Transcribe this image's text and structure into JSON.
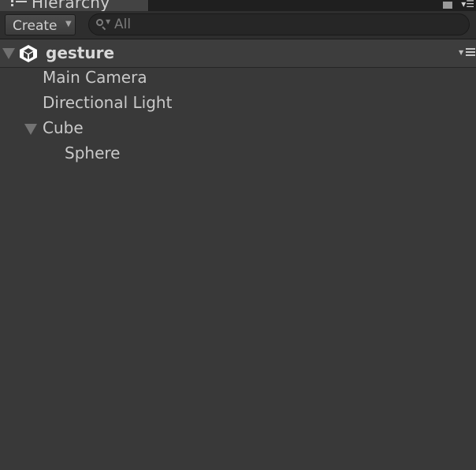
{
  "window": {
    "tab_title": "Hierarchy"
  },
  "toolbar": {
    "create_label": "Create",
    "search_placeholder": "All",
    "search_value": ""
  },
  "scene": {
    "name": "gesture",
    "icon": "unity-icon",
    "expanded": true
  },
  "hierarchy": {
    "items": [
      {
        "label": "Main Camera",
        "depth": 1,
        "has_children": false
      },
      {
        "label": "Directional Light",
        "depth": 1,
        "has_children": false
      },
      {
        "label": "Cube",
        "depth": 1,
        "has_children": true,
        "expanded": true
      },
      {
        "label": "Sphere",
        "depth": 2,
        "has_children": false
      }
    ]
  }
}
